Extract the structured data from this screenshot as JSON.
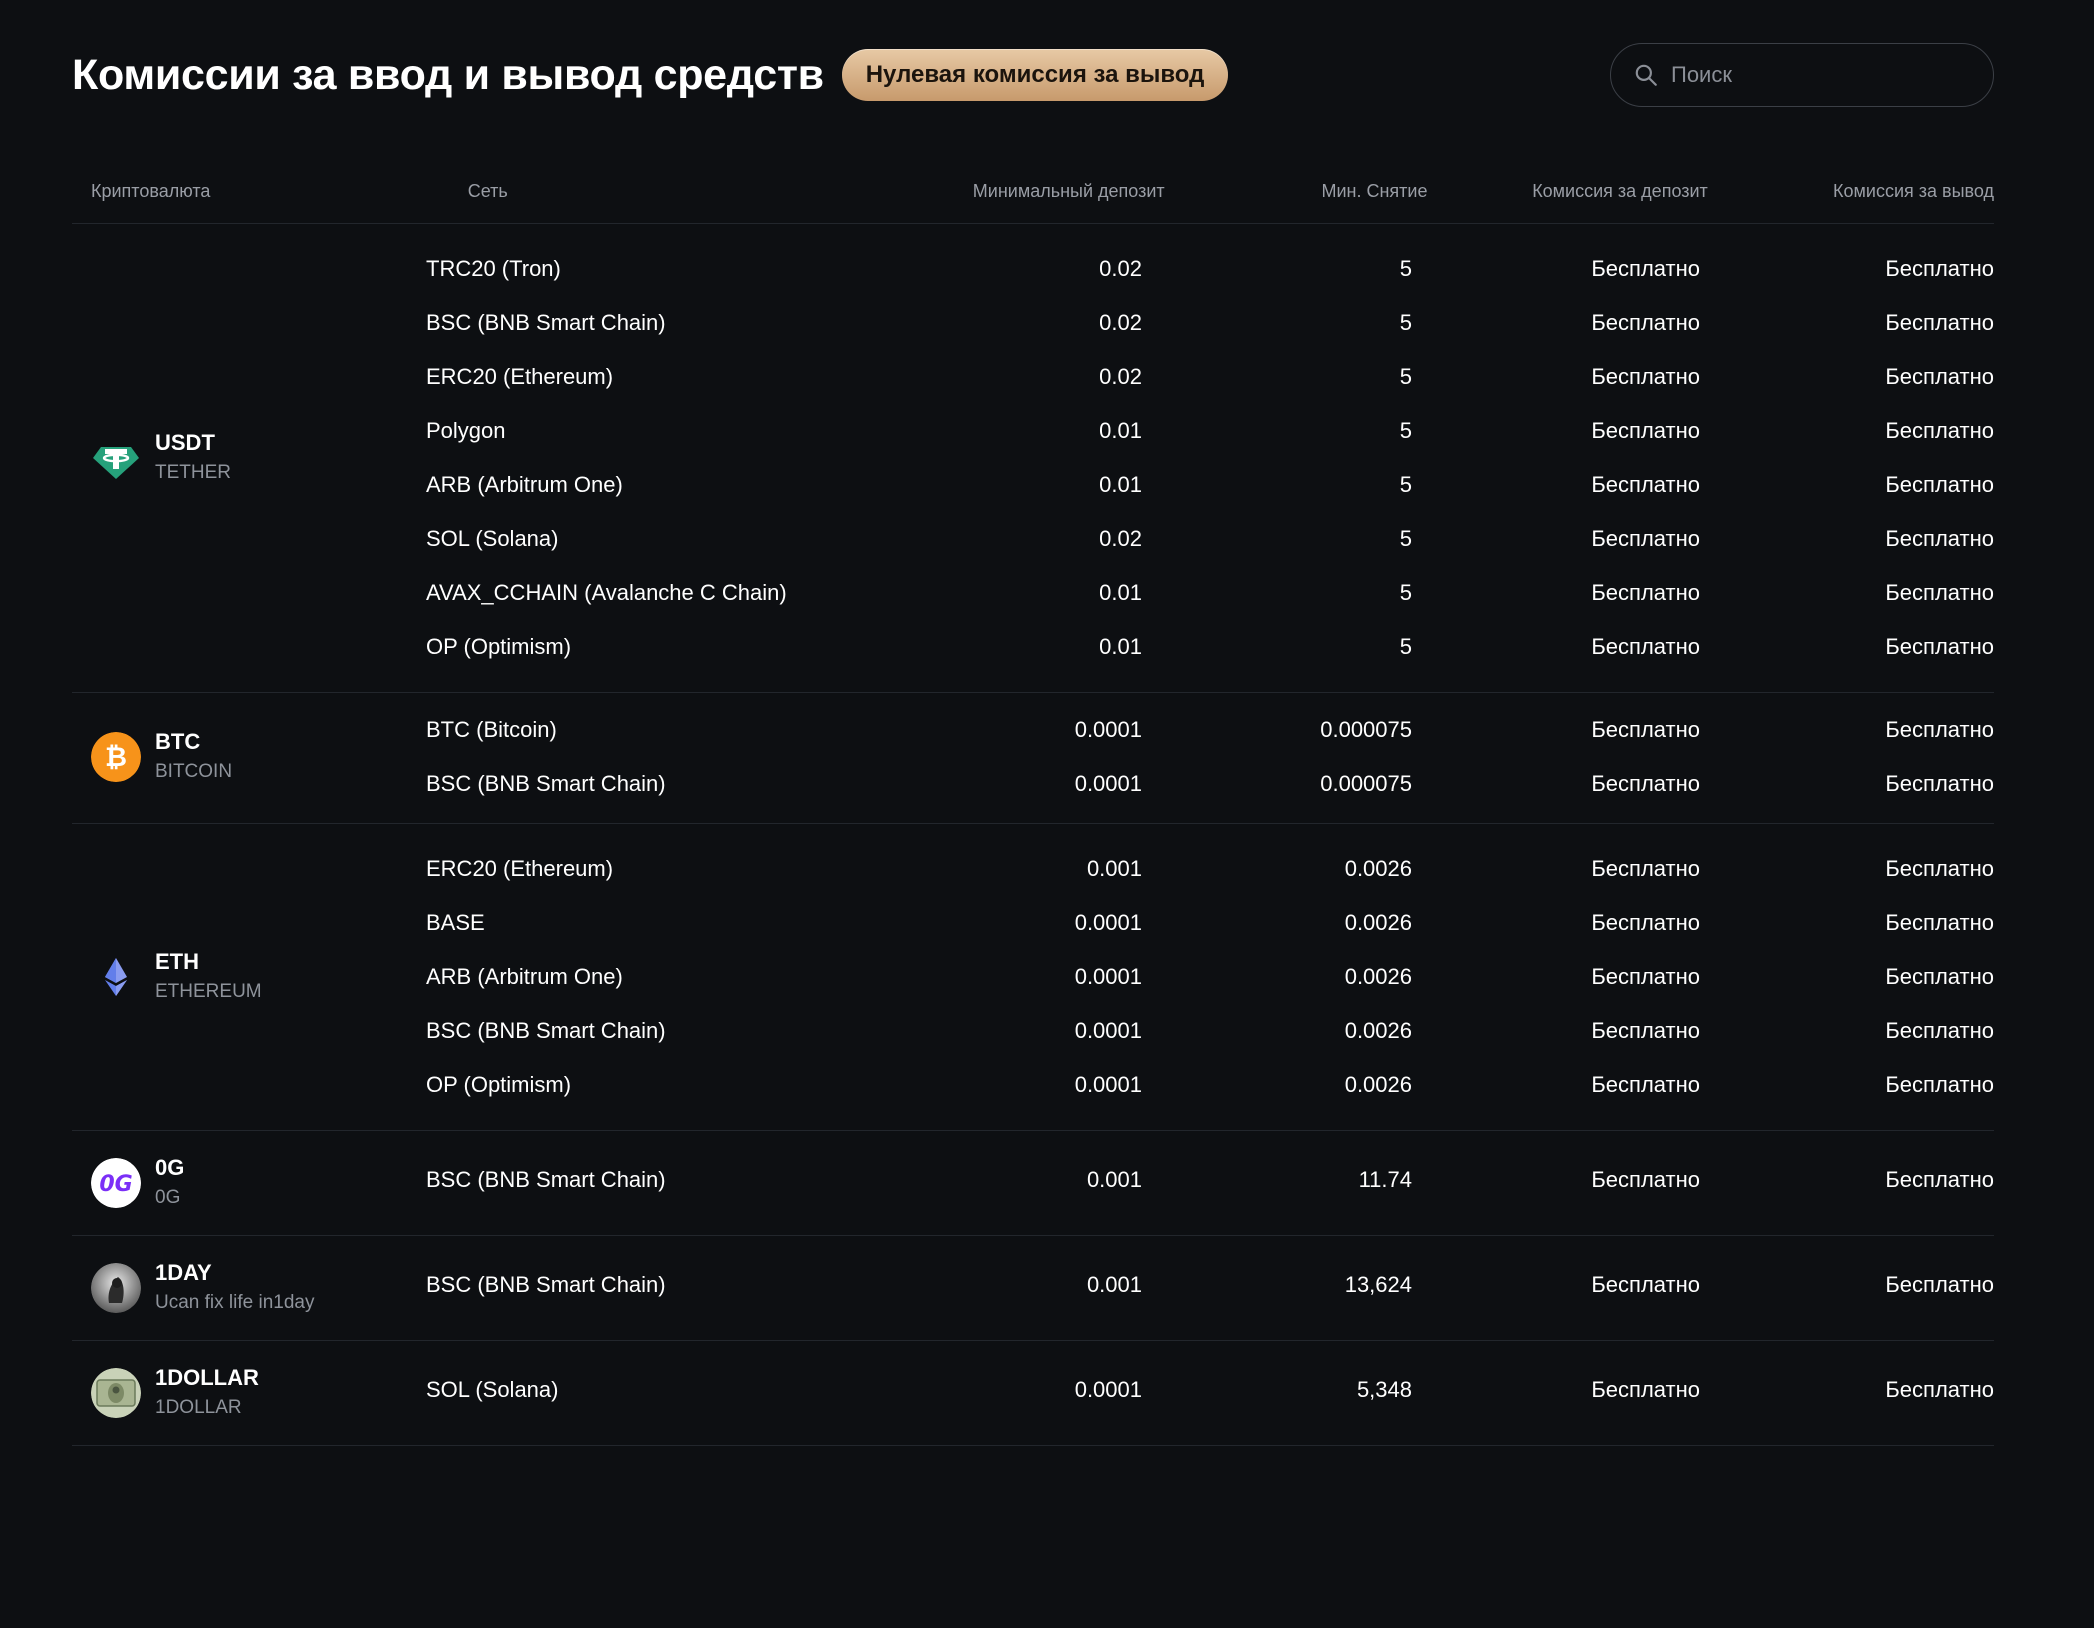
{
  "header": {
    "title": "Комиссии за ввод и вывод средств",
    "badge": "Нулевая комиссия за вывод",
    "search_placeholder": "Поиск"
  },
  "columns": {
    "crypto": "Криптовалюта",
    "network": "Сеть",
    "min_deposit": "Минимальный депозит",
    "min_withdraw": "Мин. Снятие",
    "deposit_fee": "Комиссия за депозит",
    "withdraw_fee": "Комиссия за вывод"
  },
  "assets": [
    {
      "symbol": "USDT",
      "name": "TETHER",
      "icon": "tether-icon",
      "rows": [
        {
          "network": "TRC20 (Tron)",
          "min_deposit": "0.02",
          "min_withdraw": "5",
          "deposit_fee": "Бесплатно",
          "withdraw_fee": "Бесплатно"
        },
        {
          "network": "BSC (BNB Smart Chain)",
          "min_deposit": "0.02",
          "min_withdraw": "5",
          "deposit_fee": "Бесплатно",
          "withdraw_fee": "Бесплатно"
        },
        {
          "network": "ERC20 (Ethereum)",
          "min_deposit": "0.02",
          "min_withdraw": "5",
          "deposit_fee": "Бесплатно",
          "withdraw_fee": "Бесплатно"
        },
        {
          "network": "Polygon",
          "min_deposit": "0.01",
          "min_withdraw": "5",
          "deposit_fee": "Бесплатно",
          "withdraw_fee": "Бесплатно"
        },
        {
          "network": "ARB (Arbitrum One)",
          "min_deposit": "0.01",
          "min_withdraw": "5",
          "deposit_fee": "Бесплатно",
          "withdraw_fee": "Бесплатно"
        },
        {
          "network": "SOL (Solana)",
          "min_deposit": "0.02",
          "min_withdraw": "5",
          "deposit_fee": "Бесплатно",
          "withdraw_fee": "Бесплатно"
        },
        {
          "network": "AVAX_CCHAIN (Avalanche C Chain)",
          "min_deposit": "0.01",
          "min_withdraw": "5",
          "deposit_fee": "Бесплатно",
          "withdraw_fee": "Бесплатно"
        },
        {
          "network": "OP (Optimism)",
          "min_deposit": "0.01",
          "min_withdraw": "5",
          "deposit_fee": "Бесплатно",
          "withdraw_fee": "Бесплатно"
        }
      ]
    },
    {
      "symbol": "BTC",
      "name": "BITCOIN",
      "icon": "bitcoin-icon",
      "rows": [
        {
          "network": "BTC (Bitcoin)",
          "min_deposit": "0.0001",
          "min_withdraw": "0.000075",
          "deposit_fee": "Бесплатно",
          "withdraw_fee": "Бесплатно"
        },
        {
          "network": "BSC (BNB Smart Chain)",
          "min_deposit": "0.0001",
          "min_withdraw": "0.000075",
          "deposit_fee": "Бесплатно",
          "withdraw_fee": "Бесплатно"
        }
      ]
    },
    {
      "symbol": "ETH",
      "name": "ETHEREUM",
      "icon": "ethereum-icon",
      "rows": [
        {
          "network": "ERC20 (Ethereum)",
          "min_deposit": "0.001",
          "min_withdraw": "0.0026",
          "deposit_fee": "Бесплатно",
          "withdraw_fee": "Бесплатно"
        },
        {
          "network": "BASE",
          "min_deposit": "0.0001",
          "min_withdraw": "0.0026",
          "deposit_fee": "Бесплатно",
          "withdraw_fee": "Бесплатно"
        },
        {
          "network": "ARB (Arbitrum One)",
          "min_deposit": "0.0001",
          "min_withdraw": "0.0026",
          "deposit_fee": "Бесплатно",
          "withdraw_fee": "Бесплатно"
        },
        {
          "network": "BSC (BNB Smart Chain)",
          "min_deposit": "0.0001",
          "min_withdraw": "0.0026",
          "deposit_fee": "Бесплатно",
          "withdraw_fee": "Бесплатно"
        },
        {
          "network": "OP (Optimism)",
          "min_deposit": "0.0001",
          "min_withdraw": "0.0026",
          "deposit_fee": "Бесплатно",
          "withdraw_fee": "Бесплатно"
        }
      ]
    },
    {
      "symbol": "0G",
      "name": "0G",
      "icon": "zero-g-icon",
      "rows": [
        {
          "network": "BSC (BNB Smart Chain)",
          "min_deposit": "0.001",
          "min_withdraw": "11.74",
          "deposit_fee": "Бесплатно",
          "withdraw_fee": "Бесплатно"
        }
      ]
    },
    {
      "symbol": "1DAY",
      "name": "Ucan fix life in1day",
      "icon": "oneday-icon",
      "rows": [
        {
          "network": "BSC (BNB Smart Chain)",
          "min_deposit": "0.001",
          "min_withdraw": "13,624",
          "deposit_fee": "Бесплатно",
          "withdraw_fee": "Бесплатно"
        }
      ]
    },
    {
      "symbol": "1DOLLAR",
      "name": "1DOLLAR",
      "icon": "dollar-bill-icon",
      "rows": [
        {
          "network": "SOL (Solana)",
          "min_deposit": "0.0001",
          "min_withdraw": "5,348",
          "deposit_fee": "Бесплатно",
          "withdraw_fee": "Бесплатно"
        }
      ]
    }
  ],
  "colors": {
    "background": "#0d0f12",
    "badge_from": "#e7c9a5",
    "badge_to": "#c79a6c",
    "muted_text": "#8e939b",
    "divider": "#22262c",
    "tether": "#26a17b",
    "bitcoin": "#f7931a",
    "ethereum": "#627eea",
    "zero_g": "#7b2ff7"
  }
}
